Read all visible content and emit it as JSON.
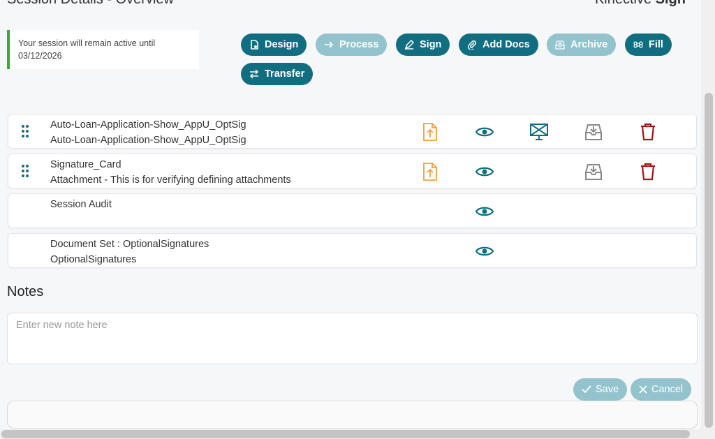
{
  "header": {
    "title_partial": "Session Details - Overview",
    "brand_light": "Kinective",
    "brand_bold": "Sign"
  },
  "session_banner": {
    "line1": "Your session will remain active until",
    "line2": "03/12/2026"
  },
  "toolbar": {
    "design": "Design",
    "process": "Process",
    "sign": "Sign",
    "add_docs": "Add Docs",
    "archive": "Archive",
    "fill": "Fill",
    "transfer": "Transfer"
  },
  "documents": [
    {
      "name": "Auto-Loan-Application-Show_AppU_OptSig",
      "desc": "Auto-Loan-Application-Show_AppU_OptSig"
    },
    {
      "name": "Signature_Card",
      "desc": "Attachment - This is for verifying defining attachments"
    },
    {
      "name": "Session Audit",
      "desc": ""
    },
    {
      "name": "Document Set : OptionalSignatures",
      "desc": "OptionalSignatures"
    }
  ],
  "notes": {
    "title": "Notes",
    "placeholder": "Enter new note here",
    "save": "Save",
    "cancel": "Cancel"
  },
  "colors": {
    "primary": "#116d80",
    "primary_disabled": "#93c3cd",
    "upload": "#f0a040",
    "delete": "#a01818",
    "archive_icon": "#888888",
    "banner_accent": "#3ca63c"
  }
}
